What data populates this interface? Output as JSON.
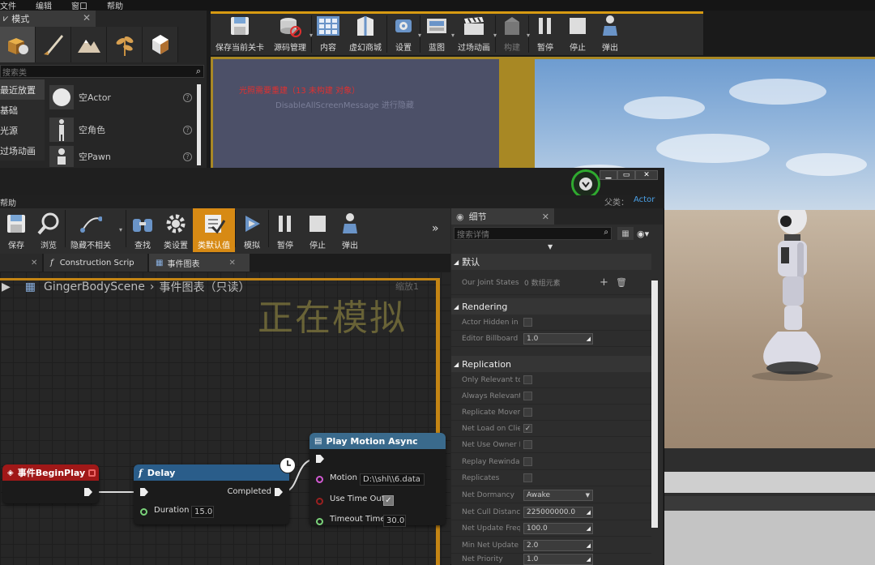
{
  "menu": {
    "items": [
      "文件",
      "编辑",
      "窗口",
      "帮助"
    ]
  },
  "modes": {
    "tab_label": "模式",
    "search_placeholder": "搜索类",
    "categories": [
      "最近放置",
      "基础",
      "光源",
      "过场动画"
    ],
    "items": [
      "空Actor",
      "空角色",
      "空Pawn"
    ]
  },
  "main_toolbar": {
    "buttons": [
      "保存当前关卡",
      "源码管理",
      "内容",
      "虚幻商城",
      "设置",
      "蓝图",
      "过场动画",
      "构建",
      "暂停",
      "停止",
      "弹出"
    ]
  },
  "viewport": {
    "warning": "光照需要重建（13 未构建 对象）",
    "sub": "DisableAllScreenMessage 进行隐藏"
  },
  "bp_window": {
    "menu_label": "帮助",
    "parent_label": "父类：",
    "parent_value": "Actor",
    "toolbar": [
      "保存",
      "浏览",
      "隐藏不相关",
      "查找",
      "类设置",
      "类默认值",
      "模拟",
      "暂停",
      "停止",
      "弹出"
    ],
    "tabs": [
      "Construction Scrip",
      "事件图表"
    ],
    "breadcrumb": {
      "asset": "GingerBodyScene",
      "graph": "事件图表（只读）"
    },
    "watermark": "正在模拟",
    "zoom": "缩放1"
  },
  "nodes": {
    "begin_play": {
      "title": "事件BeginPlay"
    },
    "delay": {
      "title": "Delay",
      "completed": "Completed",
      "duration_label": "Duration",
      "duration_value": "15.0"
    },
    "play_motion": {
      "title": "Play Motion Async",
      "motion_label": "Motion",
      "motion_value": "D:\\\\shl\\\\6.data",
      "use_time_out_label": "Use Time Out",
      "timeout_label": "Timeout Time",
      "timeout_value": "30.0"
    }
  },
  "details": {
    "tab_label": "细节",
    "search_placeholder": "搜索详情",
    "sections": {
      "default": "默认",
      "rendering": "Rendering",
      "replication": "Replication"
    },
    "joint_states_label": "Our Joint States",
    "joint_states_value": "0 数组元素",
    "rendering_rows": [
      {
        "label": "Actor Hidden in G"
      },
      {
        "label": "Editor Billboard S",
        "value": "1.0"
      }
    ],
    "replication_rows": [
      {
        "label": "Only Relevant to"
      },
      {
        "label": "Always Relevant"
      },
      {
        "label": "Replicate Movem"
      },
      {
        "label": "Net Load on Clier"
      },
      {
        "label": "Net Use Owner R"
      },
      {
        "label": "Replay Rewindab"
      },
      {
        "label": "Replicates"
      },
      {
        "label": "Net Dormancy",
        "value": "Awake"
      },
      {
        "label": "Net Cull Distance",
        "value": "225000000.0"
      },
      {
        "label": "Net Update Frequ",
        "value": "100.0"
      },
      {
        "label": "Min Net Update F",
        "value": "2.0"
      },
      {
        "label": "Net Priority",
        "value": "1.0"
      }
    ]
  },
  "colors": {
    "accent": "#d78a14",
    "event_header": "#a01818",
    "function_header": "#2a5d8a",
    "play_motion_header": "#3a6a8c"
  }
}
